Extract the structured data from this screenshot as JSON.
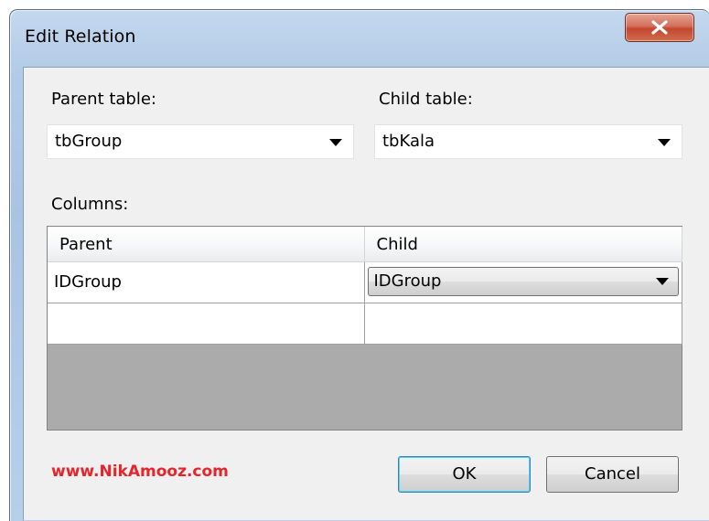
{
  "window": {
    "title": "Edit Relation"
  },
  "parent_table": {
    "label": "Parent table:",
    "value": "tbGroup"
  },
  "child_table": {
    "label": "Child table:",
    "value": "tbKala"
  },
  "columns": {
    "label": "Columns:",
    "headers": [
      "Parent",
      "Child"
    ],
    "rows": [
      {
        "parent": "IDGroup",
        "child": "IDGroup"
      },
      {
        "parent": "",
        "child": ""
      }
    ]
  },
  "watermark": "www.NikAmooz.com",
  "buttons": {
    "ok": "OK",
    "cancel": "Cancel"
  },
  "colors": {
    "watermark": "#e8242b",
    "close_button": "#c4462d",
    "grid_empty_area": "#ababab"
  },
  "icons": {
    "close": "close-icon",
    "dropdown": "chevron-down-icon"
  }
}
